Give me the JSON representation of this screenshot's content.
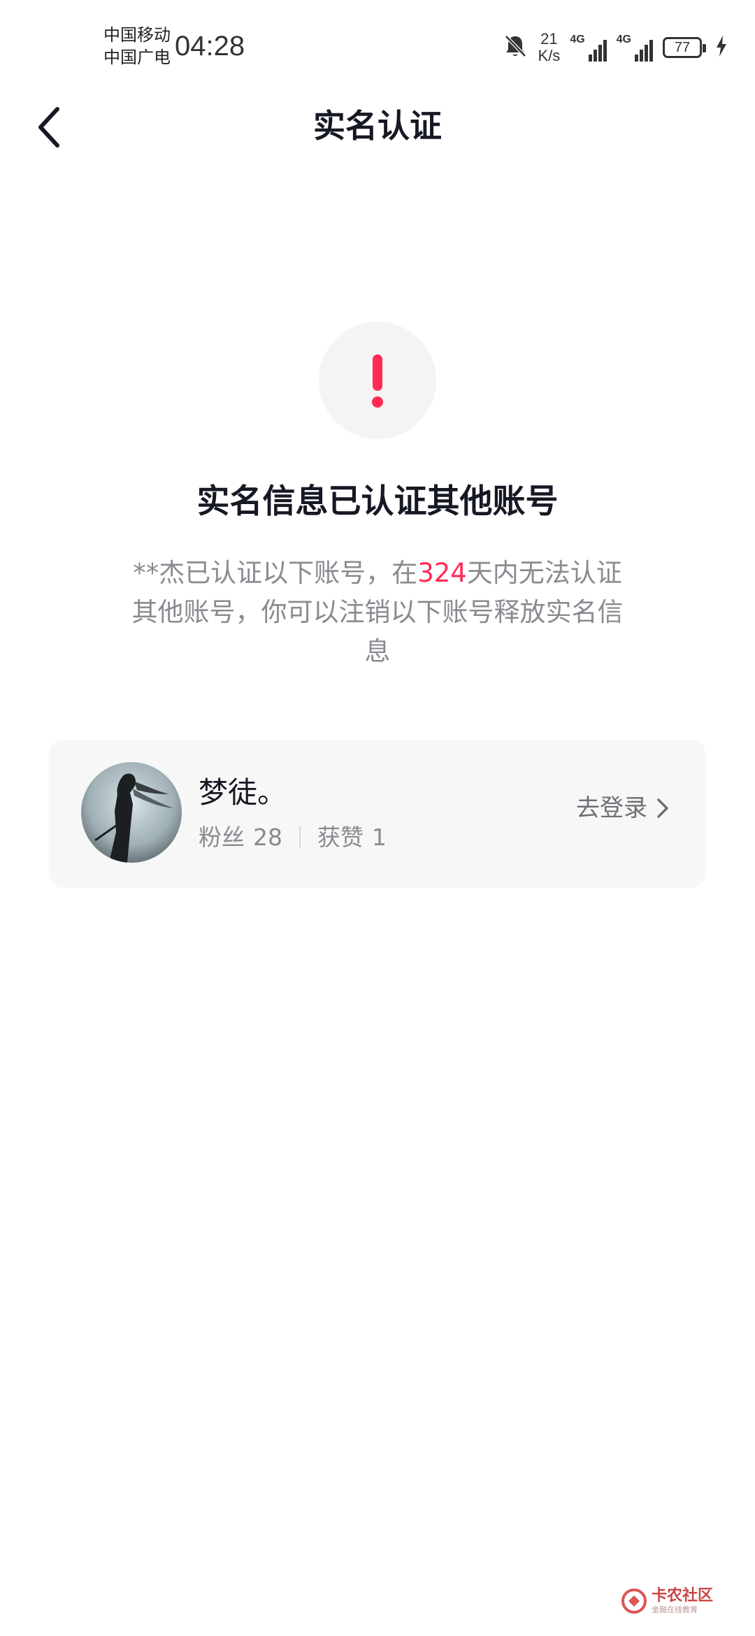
{
  "status_bar": {
    "carrier_1": "中国移动",
    "carrier_2": "中国广电",
    "time": "04:28",
    "net_speed_value": "21",
    "net_speed_unit": "K/s",
    "sim1_type": "4G",
    "sim2_type": "4G",
    "battery": "77",
    "icons": [
      "bell-muted-icon",
      "signal-icon",
      "battery-icon",
      "charging-icon"
    ]
  },
  "nav": {
    "title": "实名认证",
    "back_icon": "chevron-left-icon"
  },
  "alert": {
    "icon": "exclamation-icon",
    "accent_color": "#fe2c55",
    "headline": "实名信息已认证其他账号",
    "desc_prefix": "**杰已认证以下账号，在",
    "days": "324",
    "desc_suffix": "天内无法认证其他账号，你可以注销以下账号释放实名信息"
  },
  "account": {
    "name": "梦徒。",
    "followers_label": "粉丝",
    "followers": "28",
    "likes_label": "获赞",
    "likes": "1",
    "action_label": "去登录",
    "action_icon": "chevron-right-icon"
  },
  "watermark": {
    "title": "卡农社区",
    "subtitle": "金融在线教育"
  }
}
